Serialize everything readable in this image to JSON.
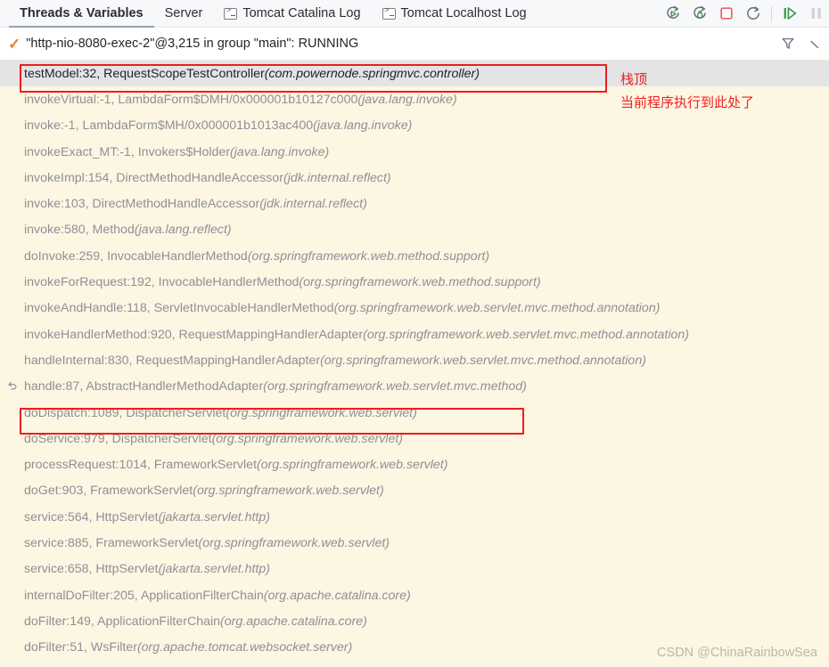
{
  "tabs": [
    {
      "label": "Threads & Variables",
      "icon": null,
      "selected": true
    },
    {
      "label": "Server",
      "icon": null,
      "selected": false
    },
    {
      "label": "Tomcat Catalina Log",
      "icon": "console-icon",
      "selected": false
    },
    {
      "label": "Tomcat Localhost Log",
      "icon": "console-icon",
      "selected": false
    }
  ],
  "toolbar": {
    "icons": [
      {
        "name": "rerun-icon"
      },
      {
        "name": "rerun-debug-icon"
      },
      {
        "name": "stop-icon"
      },
      {
        "name": "restart-icon"
      },
      {
        "name": "resume-program-icon"
      },
      {
        "name": "pause-program-icon"
      }
    ]
  },
  "thread": {
    "status_icon": "check-icon",
    "label": "\"http-nio-8080-exec-2\"@3,215 in group \"main\": RUNNING",
    "filter_icon": "filter-icon",
    "chevron_icon": "chevron-down-icon"
  },
  "annotations": {
    "stack_top": "栈顶",
    "current_execution": "当前程序执行到此处了"
  },
  "watermark": "CSDN @ChinaRainbowSea",
  "frames": [
    {
      "method": "testModel:32, RequestScopeTestController ",
      "pkg": "(com.powernode.springmvc.controller)",
      "selected": true,
      "icon": null
    },
    {
      "method": "invokeVirtual:-1, LambdaForm$DMH/0x000001b10127c000 ",
      "pkg": "(java.lang.invoke)",
      "selected": false,
      "icon": null
    },
    {
      "method": "invoke:-1, LambdaForm$MH/0x000001b1013ac400 ",
      "pkg": "(java.lang.invoke)",
      "selected": false,
      "icon": null
    },
    {
      "method": "invokeExact_MT:-1, Invokers$Holder ",
      "pkg": "(java.lang.invoke)",
      "selected": false,
      "icon": null
    },
    {
      "method": "invokeImpl:154, DirectMethodHandleAccessor ",
      "pkg": "(jdk.internal.reflect)",
      "selected": false,
      "icon": null
    },
    {
      "method": "invoke:103, DirectMethodHandleAccessor ",
      "pkg": "(jdk.internal.reflect)",
      "selected": false,
      "icon": null
    },
    {
      "method": "invoke:580, Method ",
      "pkg": "(java.lang.reflect)",
      "selected": false,
      "icon": null
    },
    {
      "method": "doInvoke:259, InvocableHandlerMethod ",
      "pkg": "(org.springframework.web.method.support)",
      "selected": false,
      "icon": null
    },
    {
      "method": "invokeForRequest:192, InvocableHandlerMethod ",
      "pkg": "(org.springframework.web.method.support)",
      "selected": false,
      "icon": null
    },
    {
      "method": "invokeAndHandle:118, ServletInvocableHandlerMethod ",
      "pkg": "(org.springframework.web.servlet.mvc.method.annotation)",
      "selected": false,
      "icon": null
    },
    {
      "method": "invokeHandlerMethod:920, RequestMappingHandlerAdapter ",
      "pkg": "(org.springframework.web.servlet.mvc.method.annotation)",
      "selected": false,
      "icon": null
    },
    {
      "method": "handleInternal:830, RequestMappingHandlerAdapter ",
      "pkg": "(org.springframework.web.servlet.mvc.method.annotation)",
      "selected": false,
      "icon": null
    },
    {
      "method": "handle:87, AbstractHandlerMethodAdapter ",
      "pkg": "(org.springframework.web.servlet.mvc.method)",
      "selected": false,
      "icon": "return-arrow-icon"
    },
    {
      "method": "doDispatch:1089, DispatcherServlet ",
      "pkg": "(org.springframework.web.servlet)",
      "selected": false,
      "icon": null
    },
    {
      "method": "doService:979, DispatcherServlet ",
      "pkg": "(org.springframework.web.servlet)",
      "selected": false,
      "icon": null
    },
    {
      "method": "processRequest:1014, FrameworkServlet ",
      "pkg": "(org.springframework.web.servlet)",
      "selected": false,
      "icon": null
    },
    {
      "method": "doGet:903, FrameworkServlet ",
      "pkg": "(org.springframework.web.servlet)",
      "selected": false,
      "icon": null
    },
    {
      "method": "service:564, HttpServlet ",
      "pkg": "(jakarta.servlet.http)",
      "selected": false,
      "icon": null
    },
    {
      "method": "service:885, FrameworkServlet ",
      "pkg": "(org.springframework.web.servlet)",
      "selected": false,
      "icon": null
    },
    {
      "method": "service:658, HttpServlet ",
      "pkg": "(jakarta.servlet.http)",
      "selected": false,
      "icon": null
    },
    {
      "method": "internalDoFilter:205, ApplicationFilterChain ",
      "pkg": "(org.apache.catalina.core)",
      "selected": false,
      "icon": null
    },
    {
      "method": "doFilter:149, ApplicationFilterChain ",
      "pkg": "(org.apache.catalina.core)",
      "selected": false,
      "icon": null
    },
    {
      "method": "doFilter:51, WsFilter ",
      "pkg": "(org.apache.tomcat.websocket.server)",
      "selected": false,
      "icon": null
    }
  ]
}
